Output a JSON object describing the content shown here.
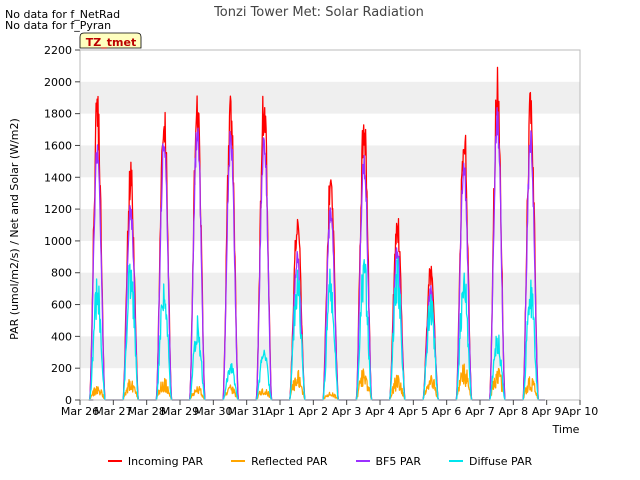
{
  "notes": [
    "No data for f_NetRad",
    "No data for f_Pyran"
  ],
  "chart_data": {
    "type": "line",
    "title": "Tonzi Tower Met: Solar Radiation",
    "xlabel": "Time",
    "ylabel": "PAR (umol/m2/s) / Net and Solar (W/m2)",
    "ylim": [
      0,
      2200
    ],
    "yticks": [
      0,
      200,
      400,
      600,
      800,
      1000,
      1200,
      1400,
      1600,
      1800,
      2000,
      2200
    ],
    "xlim": [
      0,
      15
    ],
    "xtick_labels": [
      "Mar 26",
      "Mar 27",
      "Mar 28",
      "Mar 29",
      "Mar 30",
      "Mar 31",
      "Apr 1",
      "Apr 2",
      "Apr 3",
      "Apr 4",
      "Apr 5",
      "Apr 6",
      "Apr 7",
      "Apr 8",
      "Apr 9",
      "Apr 10"
    ],
    "grid": "horizontal bands",
    "tag": "TZ_tmet",
    "legend_position": "bottom",
    "day_offsets": [
      1,
      2,
      3,
      4,
      5,
      6,
      7,
      8,
      9,
      10,
      11,
      12,
      13,
      14
    ],
    "series": [
      {
        "name": "Incoming PAR",
        "color": "#ff0000",
        "daily_peak": [
          1960,
          1510,
          1970,
          2010,
          2010,
          2030,
          1200,
          1480,
          1870,
          1220,
          880,
          1820,
          2100,
          1990
        ]
      },
      {
        "name": "Reflected PAR",
        "color": "#ffa500",
        "daily_peak": [
          95,
          140,
          140,
          95,
          95,
          90,
          200,
          60,
          210,
          160,
          170,
          230,
          230,
          160
        ]
      },
      {
        "name": "BF5 PAR",
        "color": "#9b30ff",
        "daily_peak": [
          1660,
          1250,
          1700,
          1800,
          1740,
          1760,
          940,
          1260,
          1600,
          990,
          730,
          1540,
          1850,
          1720
        ]
      },
      {
        "name": "Diffuse PAR",
        "color": "#00e5ee",
        "daily_peak": [
          800,
          960,
          800,
          530,
          250,
          360,
          880,
          840,
          950,
          930,
          720,
          880,
          450,
          790
        ]
      }
    ]
  }
}
